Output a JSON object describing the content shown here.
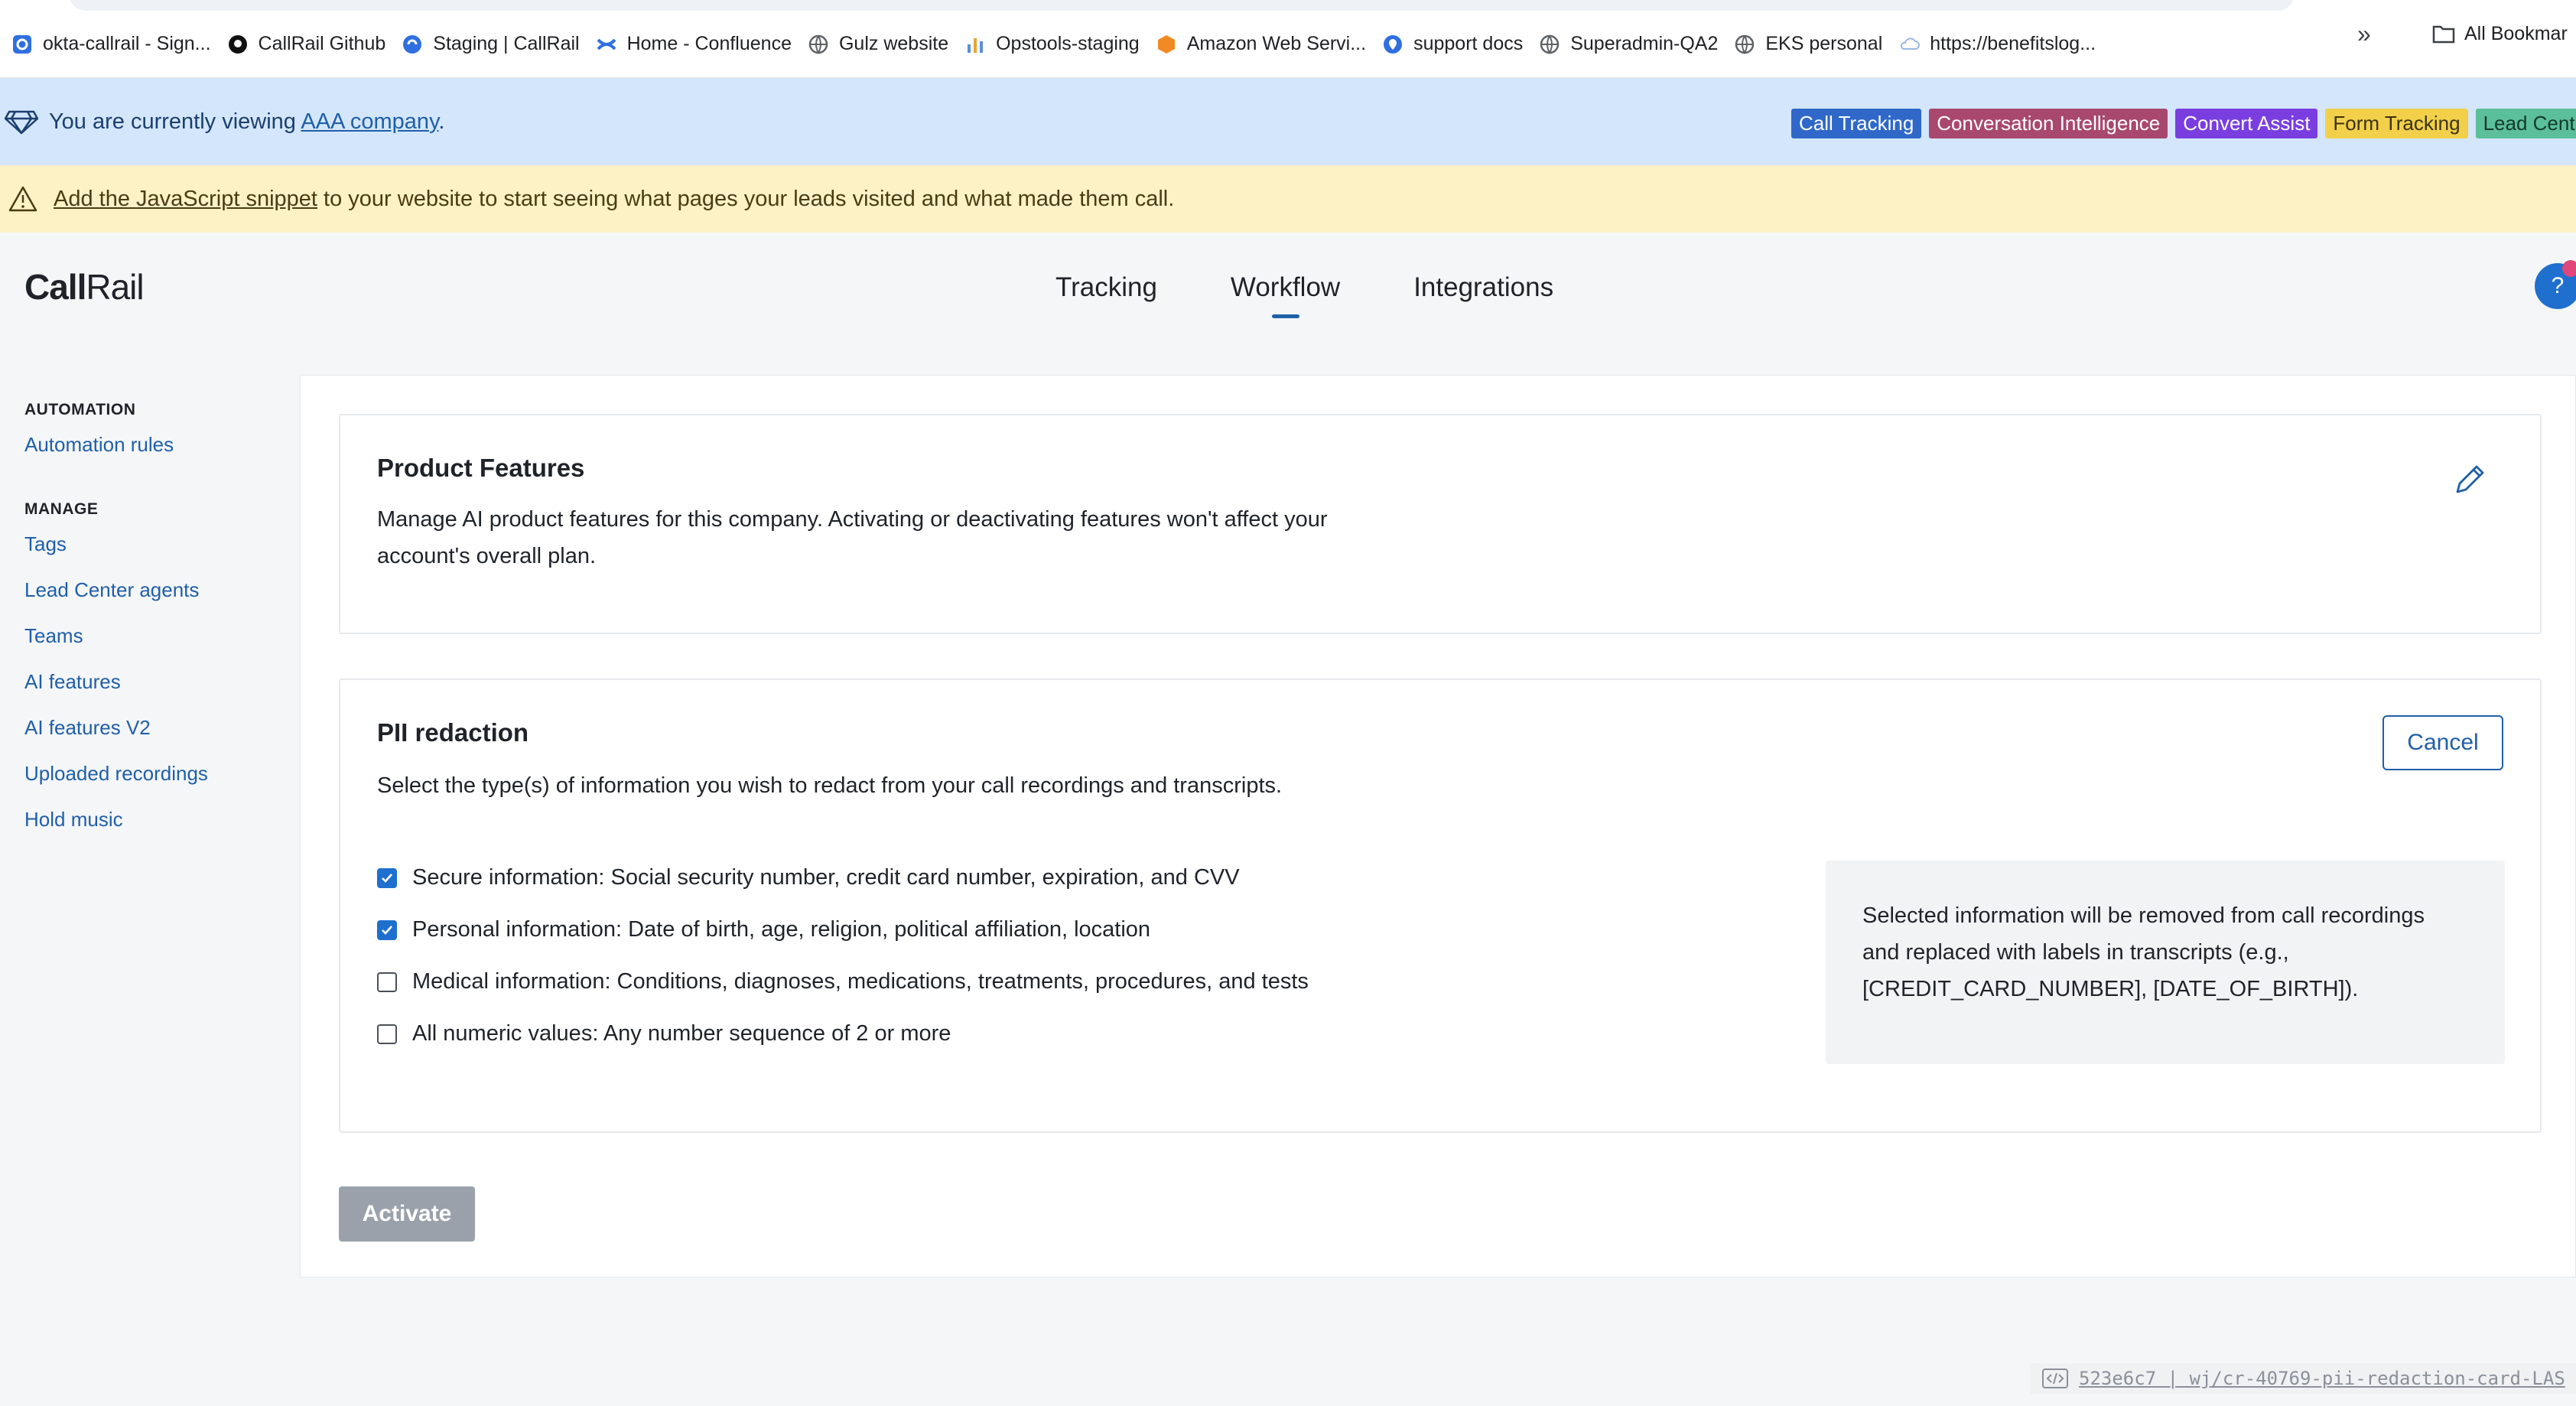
{
  "bookmarks": {
    "items": [
      {
        "label": "okta-callrail - Sign...",
        "icon": "okta-icon",
        "color": "#2f6fe0"
      },
      {
        "label": "CallRail Github",
        "icon": "github-icon",
        "color": "#111111"
      },
      {
        "label": "Staging | CallRail",
        "icon": "callrail-icon",
        "color": "#2f6fe0"
      },
      {
        "label": "Home - Confluence",
        "icon": "confluence-icon",
        "color": "#2f6fe0"
      },
      {
        "label": "Gulz website",
        "icon": "globe-icon",
        "color": "#5f6368"
      },
      {
        "label": "Opstools-staging",
        "icon": "bar-chart-icon",
        "color": "#e8a33a"
      },
      {
        "label": "Amazon Web Servi...",
        "icon": "aws-cube-icon",
        "color": "#f08a24"
      },
      {
        "label": "support docs",
        "icon": "location-pin-icon",
        "color": "#2f6fe0"
      },
      {
        "label": "Superadmin-QA2",
        "icon": "globe-icon",
        "color": "#5f6368"
      },
      {
        "label": "EKS personal",
        "icon": "globe-icon",
        "color": "#5f6368"
      },
      {
        "label": "https://benefitslog...",
        "icon": "cloud-icon",
        "color": "#9ab7e0"
      }
    ],
    "overflow": "»",
    "all_bookmarks": "All Bookmar"
  },
  "viewing_banner": {
    "prefix": "You are currently viewing ",
    "company": "AAA company",
    "suffix": ".",
    "badges": [
      {
        "label": "Call Tracking",
        "color": "#2f68c9"
      },
      {
        "label": "Conversation Intelligence",
        "color": "#a8486e"
      },
      {
        "label": "Convert Assist",
        "color": "#7a3ee0"
      },
      {
        "label": "Form Tracking",
        "color": "#f2d04a",
        "text_color": "#3b3210"
      },
      {
        "label": "Lead Cent",
        "color": "#5bbf9b",
        "text_color": "#123a2b"
      }
    ]
  },
  "warning_banner": {
    "link": "Add the JavaScript snippet",
    "text": " to your website to start seeing what pages your leads visited and what made them call."
  },
  "header": {
    "logo_bold": "Call",
    "logo_rest": "Rail",
    "nav": [
      "Tracking",
      "Workflow",
      "Integrations"
    ],
    "active_nav": "Workflow",
    "help": "?"
  },
  "sidebar": {
    "groups": [
      {
        "heading": "AUTOMATION",
        "links": [
          "Automation rules"
        ]
      },
      {
        "heading": "MANAGE",
        "links": [
          "Tags",
          "Lead Center agents",
          "Teams",
          "AI features",
          "AI features V2",
          "Uploaded recordings",
          "Hold music"
        ]
      }
    ]
  },
  "product_features": {
    "title": "Product Features",
    "description_line1": "Manage AI product features for this company. Activating or deactivating features won't affect your",
    "description_line2": "account's overall plan."
  },
  "pii": {
    "title": "PII redaction",
    "description": "Select the type(s) of information you wish to redact from your call recordings and transcripts.",
    "cancel_label": "Cancel",
    "options": [
      {
        "label": "Secure information: Social security number, credit card number, expiration, and CVV",
        "checked": true
      },
      {
        "label": "Personal information: Date of birth, age, religion, political affiliation, location",
        "checked": true
      },
      {
        "label": "Medical information: Conditions, diagnoses, medications, treatments, procedures, and tests",
        "checked": false
      },
      {
        "label": "All numeric values: Any number sequence of 2 or more",
        "checked": false
      }
    ],
    "info_line1": "Selected information will be removed from call recordings",
    "info_line2": "and replaced with labels in transcripts (e.g.,",
    "info_line3": "[CREDIT_CARD_NUMBER], [DATE_OF_BIRTH])."
  },
  "activate_label": "Activate",
  "build_tag": {
    "text": "523e6c7 | wj/cr-40769-pii-redaction-card-LAS"
  }
}
